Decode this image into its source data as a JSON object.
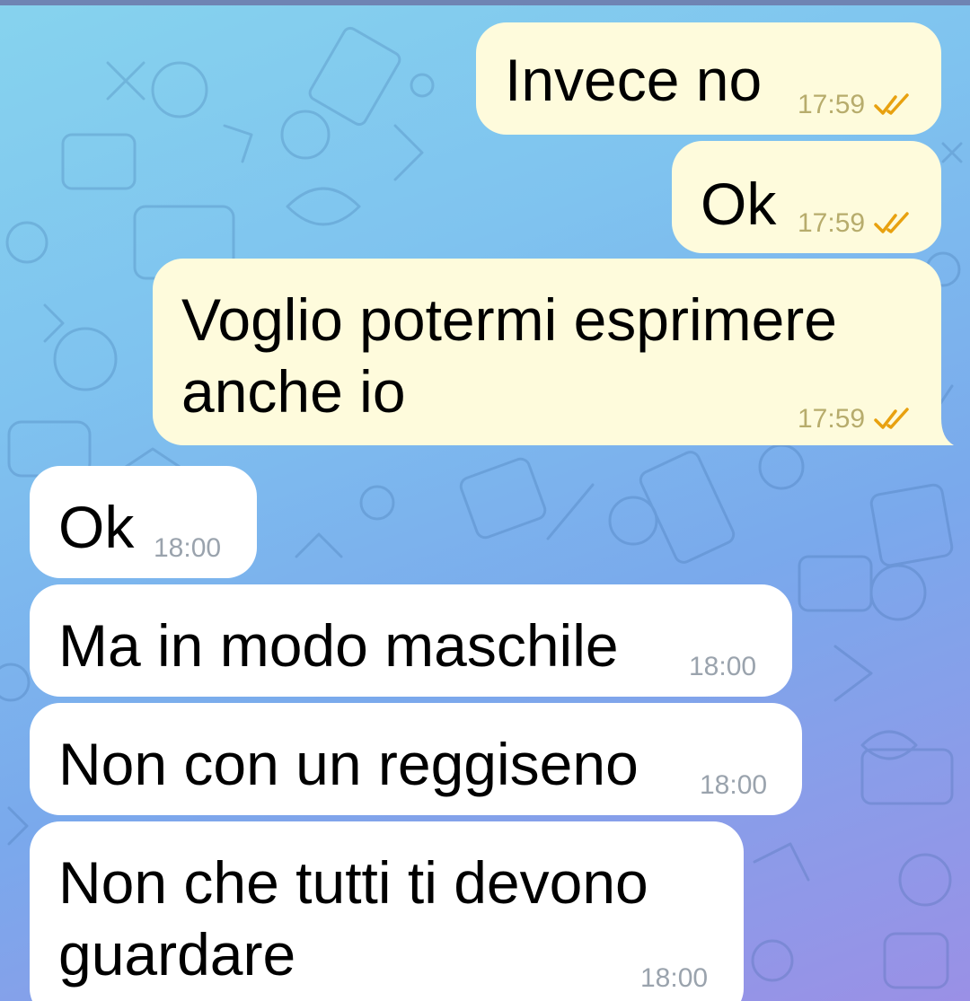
{
  "chat": {
    "theme": {
      "outgoing_bubble_color": "#fefbdc",
      "incoming_bubble_color": "#ffffff",
      "read_tick_color": "#e8a10f",
      "background_gradient": [
        "#86d3ee",
        "#7aa9ec",
        "#9a90e6"
      ]
    },
    "messages": [
      {
        "direction": "outgoing",
        "lines": [
          "Invece no"
        ],
        "time": "17:59",
        "status": "read",
        "status_icon": "double-check-icon"
      },
      {
        "direction": "outgoing",
        "lines": [
          "Ok"
        ],
        "time": "17:59",
        "status": "read",
        "status_icon": "double-check-icon"
      },
      {
        "direction": "outgoing",
        "lines": [
          "Voglio potermi esprimere",
          "anche io"
        ],
        "time": "17:59",
        "status": "read",
        "status_icon": "double-check-icon"
      },
      {
        "direction": "incoming",
        "lines": [
          "Ok"
        ],
        "time": "18:00"
      },
      {
        "direction": "incoming",
        "lines": [
          "Ma in modo maschile"
        ],
        "time": "18:00"
      },
      {
        "direction": "incoming",
        "lines": [
          "Non con un reggiseno"
        ],
        "time": "18:00"
      },
      {
        "direction": "incoming",
        "lines": [
          "Non che tutti ti devono",
          "guardare"
        ],
        "time": "18:00"
      }
    ]
  }
}
